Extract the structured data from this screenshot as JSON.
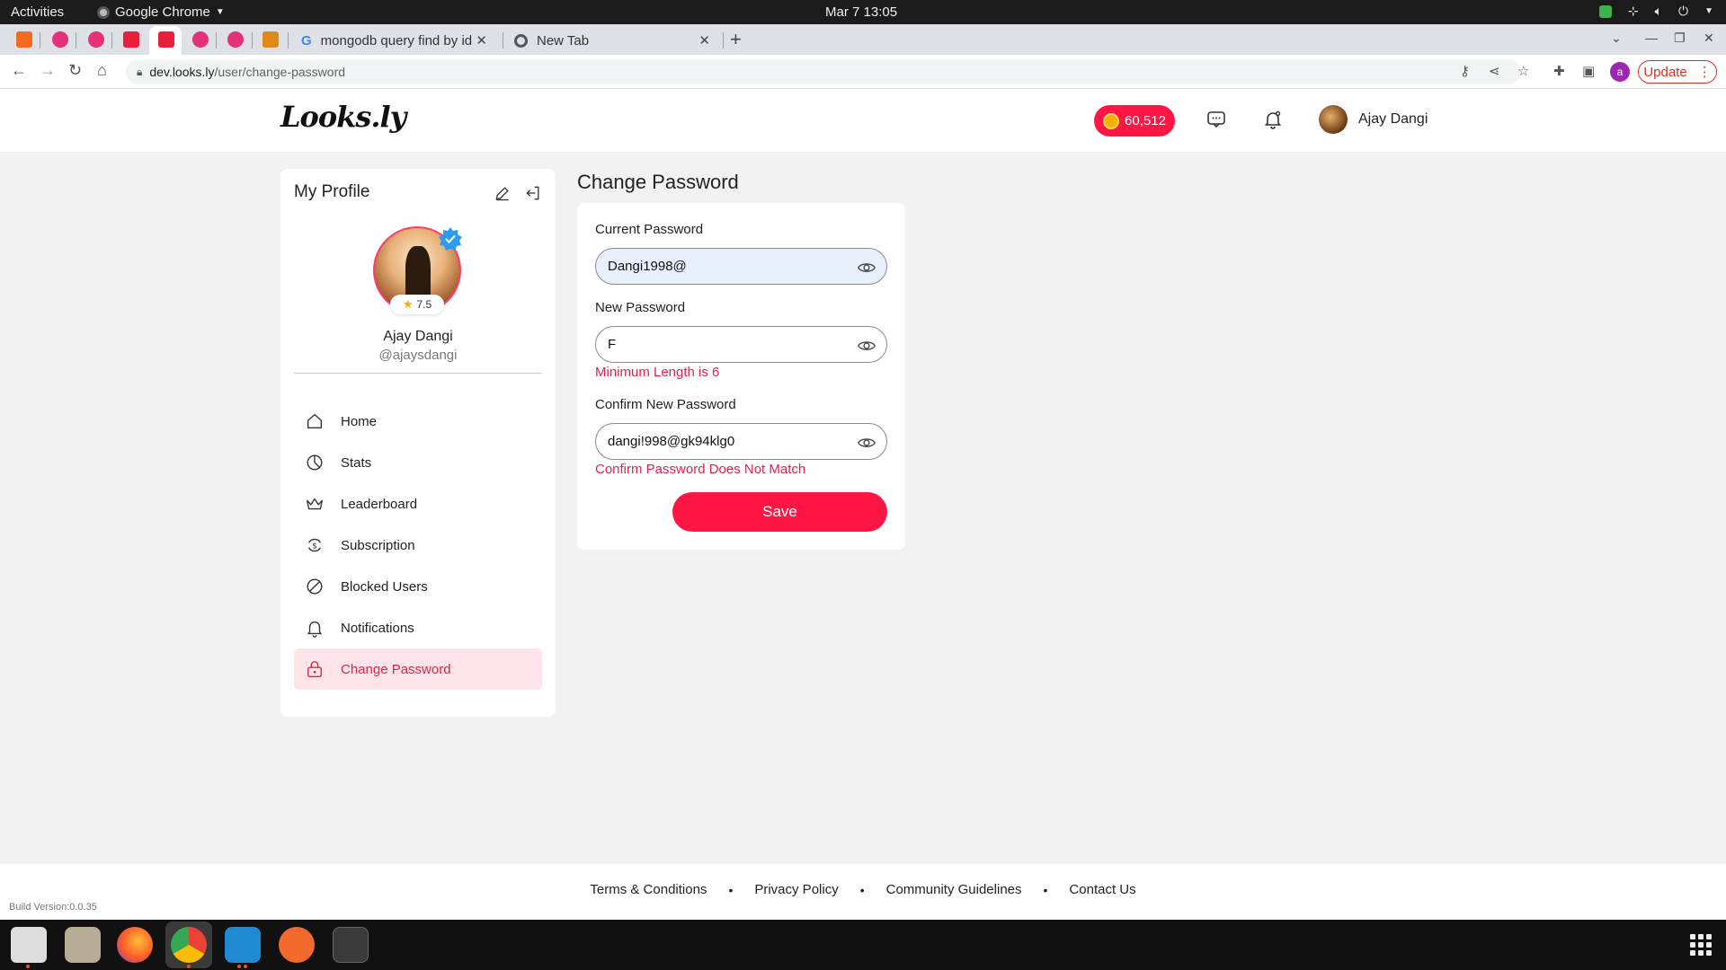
{
  "system": {
    "activities": "Activities",
    "app_name": "Google Chrome",
    "clock": "Mar 7  13:05"
  },
  "browser": {
    "tabs": [
      {
        "title": "mongodb query find by id",
        "favicon": "google-icon"
      },
      {
        "title": "New Tab",
        "favicon": "chrome-icon"
      }
    ],
    "url_host": "dev.looks.ly",
    "url_path": "/user/change-password",
    "profile_initial": "a",
    "update_label": "Update"
  },
  "header": {
    "logo": "Looks.ly",
    "coins": "60,512",
    "user_name": "Ajay Dangi"
  },
  "profile": {
    "heading": "My Profile",
    "name": "Ajay Dangi",
    "handle": "@ajaysdangi",
    "rating": "7.5",
    "menu": [
      {
        "label": "Home",
        "icon": "home-icon"
      },
      {
        "label": "Stats",
        "icon": "pie-chart-icon"
      },
      {
        "label": "Leaderboard",
        "icon": "crown-icon"
      },
      {
        "label": "Subscription",
        "icon": "dollar-cycle-icon"
      },
      {
        "label": "Blocked Users",
        "icon": "block-icon"
      },
      {
        "label": "Notifications",
        "icon": "bell-icon"
      },
      {
        "label": "Change Password",
        "icon": "lock-icon",
        "active": true
      }
    ]
  },
  "change_password": {
    "title": "Change Password",
    "current_label": "Current Password",
    "current_value": "Dangi1998@",
    "new_label": "New Password",
    "new_value": "F",
    "new_error": "Minimum Length is 6",
    "confirm_label": "Confirm New Password",
    "confirm_value": "dangi!998@gk94klg0",
    "confirm_error": "Confirm Password Does Not Match",
    "save_label": "Save"
  },
  "footer": {
    "links": [
      "Terms & Conditions",
      "Privacy Policy",
      "Community Guidelines",
      "Contact Us"
    ],
    "separator": "•",
    "build": "Build Version:0.0.35"
  },
  "colors": {
    "accent": "#ff1645",
    "active_bg": "#ffe4ea",
    "error": "#e0224b"
  }
}
